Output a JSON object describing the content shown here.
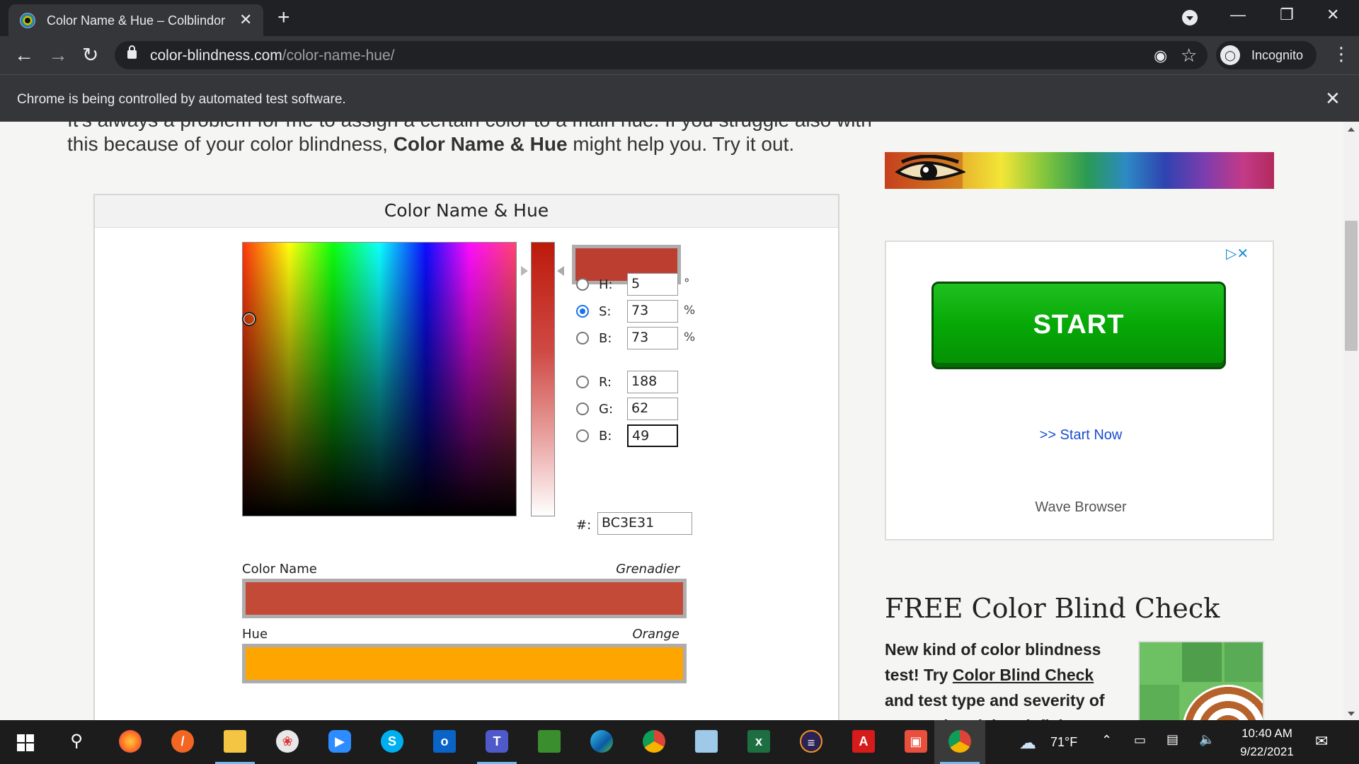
{
  "browser": {
    "tab_title": "Color Name & Hue – Colblindor",
    "tab_close": "✕",
    "new_tab": "+",
    "url_host": "color-blindness.com",
    "url_path": "/color-name-hue/",
    "incognito_label": "Incognito",
    "infobar_text": "Chrome is being controlled by automated test software.",
    "infobar_close": "✕"
  },
  "page": {
    "intro_cut": "It's always a problem for me to assign a certain color to a main hue. If you struggle also with",
    "intro_prefix": "this because of your color blindness, ",
    "intro_bold": "Color Name & Hue",
    "intro_suffix": " might help you. Try it out."
  },
  "widget": {
    "title": "Color Name & Hue",
    "preview_color": "#BC3E31",
    "fields": [
      {
        "label": "H:",
        "value": "5",
        "unit": "°",
        "checked": false
      },
      {
        "label": "S:",
        "value": "73",
        "unit": "%",
        "checked": true
      },
      {
        "label": "B:",
        "value": "73",
        "unit": "%",
        "checked": false
      },
      {
        "label": "R:",
        "value": "188",
        "unit": "",
        "checked": false
      },
      {
        "label": "G:",
        "value": "62",
        "unit": "",
        "checked": false
      },
      {
        "label": "B:",
        "value": "49",
        "unit": "",
        "checked": false
      }
    ],
    "hex_label": "#:",
    "hex_value": "BC3E31",
    "color_name_label": "Color Name",
    "color_name_value": "Grenadier",
    "color_name_swatch": "#C24A37",
    "hue_label": "Hue",
    "hue_value": "Orange",
    "hue_swatch": "#FFA500"
  },
  "sidebar": {
    "ad_start": "START",
    "ad_link": ">> Start Now",
    "ad_brand": "Wave Browser",
    "ad_choices": "▷✕",
    "free_title": "FREE Color Blind Check",
    "free_text_1": "New kind of color blindness test! Try ",
    "free_link": "Color Blind Check",
    "free_text_2": " and test type and severity of your color vision deficiency."
  },
  "taskbar": {
    "weather": "71°F",
    "time": "10:40 AM",
    "date": "9/22/2021"
  }
}
